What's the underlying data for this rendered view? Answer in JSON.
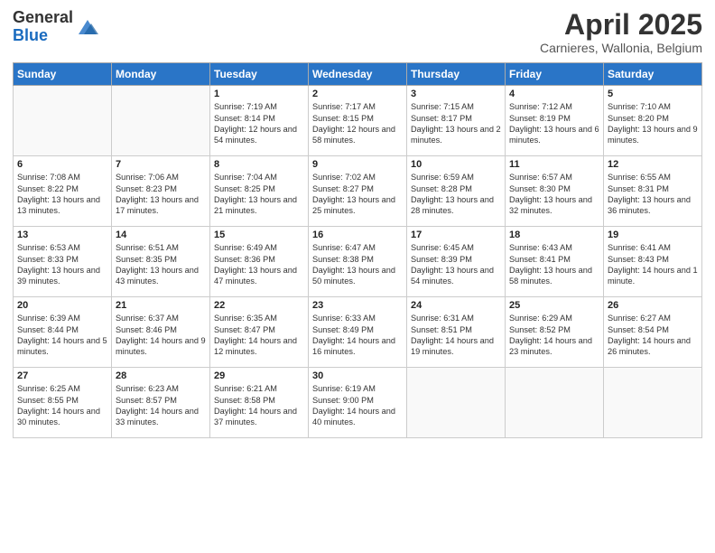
{
  "logo": {
    "general": "General",
    "blue": "Blue"
  },
  "header": {
    "month": "April 2025",
    "location": "Carnieres, Wallonia, Belgium"
  },
  "days_of_week": [
    "Sunday",
    "Monday",
    "Tuesday",
    "Wednesday",
    "Thursday",
    "Friday",
    "Saturday"
  ],
  "weeks": [
    [
      {
        "day": "",
        "content": ""
      },
      {
        "day": "",
        "content": ""
      },
      {
        "day": "1",
        "content": "Sunrise: 7:19 AM\nSunset: 8:14 PM\nDaylight: 12 hours\nand 54 minutes."
      },
      {
        "day": "2",
        "content": "Sunrise: 7:17 AM\nSunset: 8:15 PM\nDaylight: 12 hours\nand 58 minutes."
      },
      {
        "day": "3",
        "content": "Sunrise: 7:15 AM\nSunset: 8:17 PM\nDaylight: 13 hours\nand 2 minutes."
      },
      {
        "day": "4",
        "content": "Sunrise: 7:12 AM\nSunset: 8:19 PM\nDaylight: 13 hours\nand 6 minutes."
      },
      {
        "day": "5",
        "content": "Sunrise: 7:10 AM\nSunset: 8:20 PM\nDaylight: 13 hours\nand 9 minutes."
      }
    ],
    [
      {
        "day": "6",
        "content": "Sunrise: 7:08 AM\nSunset: 8:22 PM\nDaylight: 13 hours\nand 13 minutes."
      },
      {
        "day": "7",
        "content": "Sunrise: 7:06 AM\nSunset: 8:23 PM\nDaylight: 13 hours\nand 17 minutes."
      },
      {
        "day": "8",
        "content": "Sunrise: 7:04 AM\nSunset: 8:25 PM\nDaylight: 13 hours\nand 21 minutes."
      },
      {
        "day": "9",
        "content": "Sunrise: 7:02 AM\nSunset: 8:27 PM\nDaylight: 13 hours\nand 25 minutes."
      },
      {
        "day": "10",
        "content": "Sunrise: 6:59 AM\nSunset: 8:28 PM\nDaylight: 13 hours\nand 28 minutes."
      },
      {
        "day": "11",
        "content": "Sunrise: 6:57 AM\nSunset: 8:30 PM\nDaylight: 13 hours\nand 32 minutes."
      },
      {
        "day": "12",
        "content": "Sunrise: 6:55 AM\nSunset: 8:31 PM\nDaylight: 13 hours\nand 36 minutes."
      }
    ],
    [
      {
        "day": "13",
        "content": "Sunrise: 6:53 AM\nSunset: 8:33 PM\nDaylight: 13 hours\nand 39 minutes."
      },
      {
        "day": "14",
        "content": "Sunrise: 6:51 AM\nSunset: 8:35 PM\nDaylight: 13 hours\nand 43 minutes."
      },
      {
        "day": "15",
        "content": "Sunrise: 6:49 AM\nSunset: 8:36 PM\nDaylight: 13 hours\nand 47 minutes."
      },
      {
        "day": "16",
        "content": "Sunrise: 6:47 AM\nSunset: 8:38 PM\nDaylight: 13 hours\nand 50 minutes."
      },
      {
        "day": "17",
        "content": "Sunrise: 6:45 AM\nSunset: 8:39 PM\nDaylight: 13 hours\nand 54 minutes."
      },
      {
        "day": "18",
        "content": "Sunrise: 6:43 AM\nSunset: 8:41 PM\nDaylight: 13 hours\nand 58 minutes."
      },
      {
        "day": "19",
        "content": "Sunrise: 6:41 AM\nSunset: 8:43 PM\nDaylight: 14 hours\nand 1 minute."
      }
    ],
    [
      {
        "day": "20",
        "content": "Sunrise: 6:39 AM\nSunset: 8:44 PM\nDaylight: 14 hours\nand 5 minutes."
      },
      {
        "day": "21",
        "content": "Sunrise: 6:37 AM\nSunset: 8:46 PM\nDaylight: 14 hours\nand 9 minutes."
      },
      {
        "day": "22",
        "content": "Sunrise: 6:35 AM\nSunset: 8:47 PM\nDaylight: 14 hours\nand 12 minutes."
      },
      {
        "day": "23",
        "content": "Sunrise: 6:33 AM\nSunset: 8:49 PM\nDaylight: 14 hours\nand 16 minutes."
      },
      {
        "day": "24",
        "content": "Sunrise: 6:31 AM\nSunset: 8:51 PM\nDaylight: 14 hours\nand 19 minutes."
      },
      {
        "day": "25",
        "content": "Sunrise: 6:29 AM\nSunset: 8:52 PM\nDaylight: 14 hours\nand 23 minutes."
      },
      {
        "day": "26",
        "content": "Sunrise: 6:27 AM\nSunset: 8:54 PM\nDaylight: 14 hours\nand 26 minutes."
      }
    ],
    [
      {
        "day": "27",
        "content": "Sunrise: 6:25 AM\nSunset: 8:55 PM\nDaylight: 14 hours\nand 30 minutes."
      },
      {
        "day": "28",
        "content": "Sunrise: 6:23 AM\nSunset: 8:57 PM\nDaylight: 14 hours\nand 33 minutes."
      },
      {
        "day": "29",
        "content": "Sunrise: 6:21 AM\nSunset: 8:58 PM\nDaylight: 14 hours\nand 37 minutes."
      },
      {
        "day": "30",
        "content": "Sunrise: 6:19 AM\nSunset: 9:00 PM\nDaylight: 14 hours\nand 40 minutes."
      },
      {
        "day": "",
        "content": ""
      },
      {
        "day": "",
        "content": ""
      },
      {
        "day": "",
        "content": ""
      }
    ]
  ]
}
